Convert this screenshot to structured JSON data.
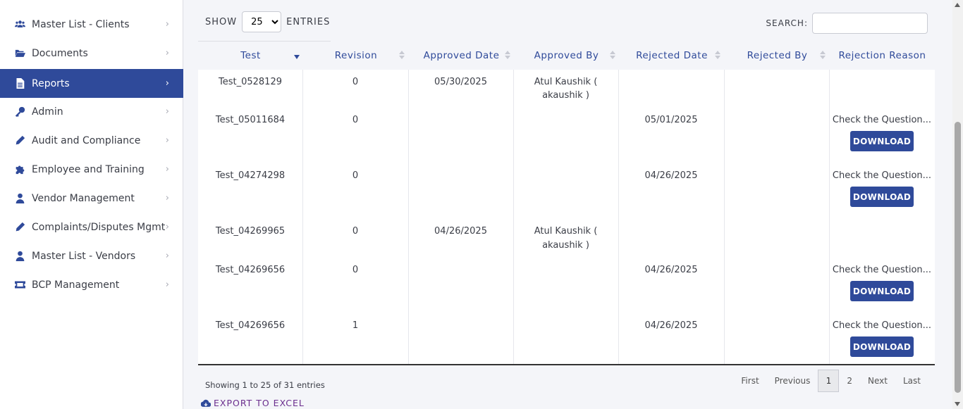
{
  "sidebar": {
    "items": [
      {
        "label": "Master List - Clients",
        "icon": "users-icon"
      },
      {
        "label": "Documents",
        "icon": "folder-open-icon"
      },
      {
        "label": "Reports",
        "icon": "file-icon",
        "active": true
      },
      {
        "label": "Admin",
        "icon": "key-icon"
      },
      {
        "label": "Audit and Compliance",
        "icon": "pencil-icon"
      },
      {
        "label": "Employee and Training",
        "icon": "puzzle-icon"
      },
      {
        "label": "Vendor Management",
        "icon": "user-icon"
      },
      {
        "label": "Complaints/Disputes Mgmt",
        "icon": "pencil-icon"
      },
      {
        "label": "Master List - Vendors",
        "icon": "user-icon"
      },
      {
        "label": "BCP Management",
        "icon": "ticket-icon"
      }
    ],
    "chevron": "›"
  },
  "controls": {
    "show_label": "SHOW",
    "entries_label": "ENTRIES",
    "page_size": "25",
    "search_label": "SEARCH:",
    "search_value": ""
  },
  "table": {
    "columns": [
      "Test",
      "Revision",
      "Approved Date",
      "Approved By",
      "Rejected Date",
      "Rejected By",
      "Rejection Reason"
    ],
    "download_label": "DOWNLOAD",
    "rows": [
      {
        "test": "Test_0528129",
        "revision": "0",
        "approved_date": "05/30/2025",
        "approved_by_1": "Atul Kaushik (",
        "approved_by_2": "akaushik )",
        "rejected_date": "",
        "rejected_by": "",
        "reason": ""
      },
      {
        "test": "Test_05011684",
        "revision": "0",
        "approved_date": "",
        "approved_by_1": "",
        "approved_by_2": "",
        "rejected_date": "05/01/2025",
        "rejected_by": "",
        "reason": "Check the Question..."
      },
      {
        "test": "Test_04274298",
        "revision": "0",
        "approved_date": "",
        "approved_by_1": "",
        "approved_by_2": "",
        "rejected_date": "04/26/2025",
        "rejected_by": "",
        "reason": "Check the Question..."
      },
      {
        "test": "Test_04269965",
        "revision": "0",
        "approved_date": "04/26/2025",
        "approved_by_1": "Atul Kaushik (",
        "approved_by_2": "akaushik )",
        "rejected_date": "",
        "rejected_by": "",
        "reason": ""
      },
      {
        "test": "Test_04269656",
        "revision": "0",
        "approved_date": "",
        "approved_by_1": "",
        "approved_by_2": "",
        "rejected_date": "04/26/2025",
        "rejected_by": "",
        "reason": "Check the Question..."
      },
      {
        "test": "Test_04269656",
        "revision": "1",
        "approved_date": "",
        "approved_by_1": "",
        "approved_by_2": "",
        "rejected_date": "04/26/2025",
        "rejected_by": "",
        "reason": "Check the Question..."
      }
    ]
  },
  "footer": {
    "info": "Showing 1 to 25 of 31 entries",
    "pager": {
      "first": "First",
      "previous": "Previous",
      "page1": "1",
      "page2": "2",
      "next": "Next",
      "last": "Last"
    },
    "export_label": "EXPORT TO EXCEL"
  },
  "colors": {
    "accent": "#2f4a9a",
    "export": "#6b2e8e"
  }
}
